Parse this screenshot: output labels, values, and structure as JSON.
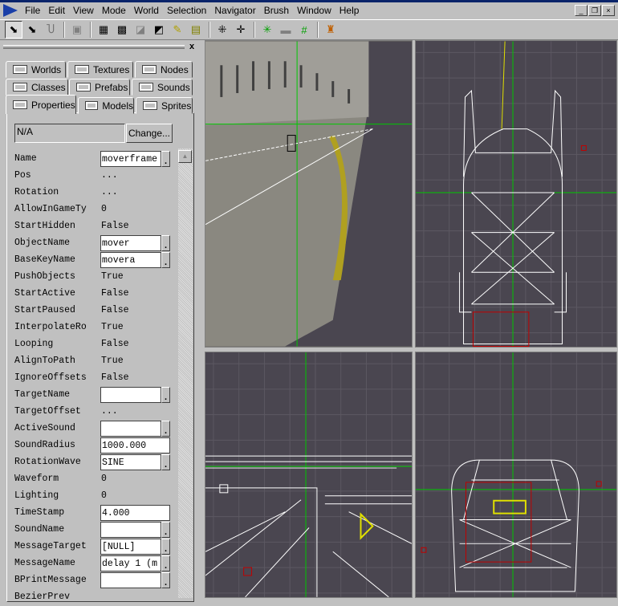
{
  "menu": [
    "File",
    "Edit",
    "View",
    "Mode",
    "World",
    "Selection",
    "Navigator",
    "Brush",
    "Window",
    "Help"
  ],
  "window_buttons": [
    "_",
    "❐",
    "×"
  ],
  "toolbar_icons": [
    "camera-move-icon",
    "camera-rotate-icon",
    "magnet-icon",
    "brush-icon",
    "scale-icon",
    "snap-grid-icon",
    "resize-icon",
    "vertex-icon",
    "texture-pick-icon",
    "texture-apply-icon",
    "center-crosshair-icon",
    "axis-icon",
    "grid-green-icon",
    "grid-plane-icon",
    "grid-snap-icon",
    "play-icon"
  ],
  "panel": {
    "close": "x",
    "tabs_row1": [
      "Worlds",
      "Textures",
      "Nodes"
    ],
    "tabs_row2": [
      "Classes",
      "Prefabs",
      "Sounds"
    ],
    "tabs_row3": [
      "Properties",
      "Models",
      "Sprites"
    ],
    "class_value": "N/A",
    "change_label": "Change...",
    "properties": [
      {
        "name": "Name",
        "type": "text",
        "value": "moverframe"
      },
      {
        "name": "Pos",
        "type": "button",
        "value": "..."
      },
      {
        "name": "Rotation",
        "type": "button",
        "value": "..."
      },
      {
        "name": "AllowInGameTy",
        "type": "button",
        "value": "0"
      },
      {
        "name": "StartHidden",
        "type": "button",
        "value": "False"
      },
      {
        "name": "ObjectName",
        "type": "text",
        "value": "mover"
      },
      {
        "name": "BaseKeyName",
        "type": "text",
        "value": "movera"
      },
      {
        "name": "PushObjects",
        "type": "button",
        "value": "True"
      },
      {
        "name": "StartActive",
        "type": "button",
        "value": "False"
      },
      {
        "name": "StartPaused",
        "type": "button",
        "value": "False"
      },
      {
        "name": "InterpolateRo",
        "type": "button",
        "value": "True"
      },
      {
        "name": "Looping",
        "type": "button",
        "value": "False"
      },
      {
        "name": "AlignToPath",
        "type": "button",
        "value": "True"
      },
      {
        "name": "IgnoreOffsets",
        "type": "button",
        "value": "False"
      },
      {
        "name": "TargetName",
        "type": "text",
        "value": ""
      },
      {
        "name": "TargetOffset",
        "type": "button",
        "value": "..."
      },
      {
        "name": "ActiveSound",
        "type": "text",
        "value": ""
      },
      {
        "name": "SoundRadius",
        "type": "wide",
        "value": "1000.000"
      },
      {
        "name": "RotationWave",
        "type": "text",
        "value": "SINE"
      },
      {
        "name": "Waveform",
        "type": "button",
        "value": "0"
      },
      {
        "name": "Lighting",
        "type": "button",
        "value": "0"
      },
      {
        "name": "TimeStamp",
        "type": "wide",
        "value": "4.000"
      },
      {
        "name": "SoundName",
        "type": "text",
        "value": ""
      },
      {
        "name": "MessageTarget",
        "type": "text",
        "value": "[NULL]"
      },
      {
        "name": "MessageName",
        "type": "text",
        "value": "delay 1 (m"
      },
      {
        "name": "BPrintMessage",
        "type": "text",
        "value": ""
      },
      {
        "name": "BezierPrev",
        "type": "button",
        "value": ""
      }
    ]
  },
  "colors": {
    "viewport_bg": "#4a4650",
    "grid": "#5c5862",
    "wire": "#ffffff",
    "axis": "#00c800",
    "selection": "#e0e000"
  }
}
